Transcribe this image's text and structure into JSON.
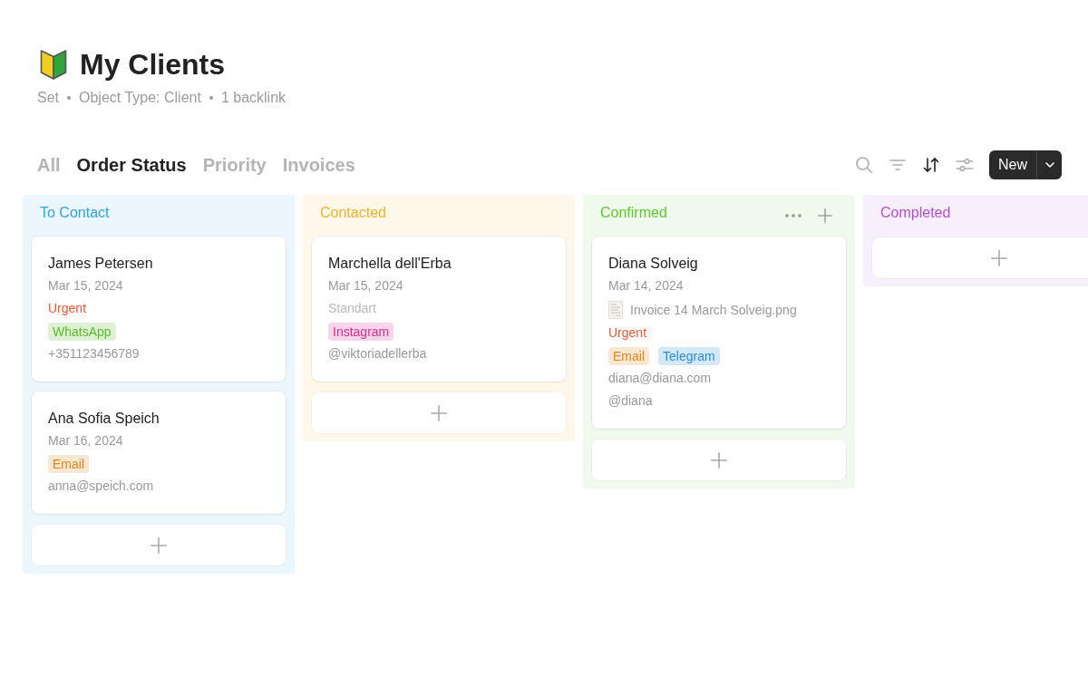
{
  "page": {
    "title": "My Clients",
    "meta": [
      "Set",
      "Object Type: Client",
      "1 backlink"
    ]
  },
  "tabs": [
    {
      "label": "All",
      "selected": false
    },
    {
      "label": "Order Status",
      "selected": true
    },
    {
      "label": "Priority",
      "selected": false
    },
    {
      "label": "Invoices",
      "selected": false
    }
  ],
  "toolbar": {
    "tools": [
      {
        "kind": "search",
        "active": false
      },
      {
        "kind": "filter",
        "active": false
      },
      {
        "kind": "sort",
        "active": true
      },
      {
        "kind": "settings",
        "active": false
      }
    ],
    "new_button": {
      "label": "New"
    }
  },
  "board": {
    "columns": [
      {
        "title": "To Contact",
        "color": "#2ea3e8",
        "hovered": false,
        "cards": [
          {
            "name": "James Petersen",
            "fields": [
              {
                "kind": "date",
                "text": "Mar 15, 2024"
              },
              {
                "kind": "priority",
                "text": "Urgent",
                "color": "#f2562f"
              },
              {
                "kind": "tags",
                "tags": [
                  {
                    "label": "WhatsApp",
                    "color": "#5cb82a"
                  }
                ]
              },
              {
                "kind": "text",
                "text": "+351123456789"
              }
            ]
          },
          {
            "name": "Ana Sofia Speich",
            "fields": [
              {
                "kind": "date",
                "text": "Mar 16, 2024"
              },
              {
                "kind": "tags",
                "tags": [
                  {
                    "label": "Email",
                    "color": "#e3861b"
                  }
                ]
              },
              {
                "kind": "text",
                "text": "anna@speich.com"
              }
            ]
          }
        ]
      },
      {
        "title": "Contacted",
        "color": "#f5b226",
        "hovered": false,
        "cards": [
          {
            "name": "Marchella dell'Erba",
            "fields": [
              {
                "kind": "date",
                "text": "Mar 15, 2024"
              },
              {
                "kind": "priority",
                "text": "Standart",
                "color": "#b9b9b9"
              },
              {
                "kind": "tags",
                "tags": [
                  {
                    "label": "Instagram",
                    "color": "#de2d8e"
                  }
                ]
              },
              {
                "kind": "text",
                "text": "@viktoriadellerba"
              }
            ]
          }
        ]
      },
      {
        "title": "Confirmed",
        "color": "#5cc92e",
        "hovered": true,
        "cards": [
          {
            "name": "Diana Solveig",
            "fields": [
              {
                "kind": "date",
                "text": "Mar 14, 2024"
              },
              {
                "kind": "file",
                "text": "Invoice 14 March Solveig.png"
              },
              {
                "kind": "priority",
                "text": "Urgent",
                "color": "#f2562f"
              },
              {
                "kind": "tags",
                "tags": [
                  {
                    "label": "Email",
                    "color": "#e3861b"
                  },
                  {
                    "label": "Telegram",
                    "color": "#2a8ed6"
                  }
                ]
              },
              {
                "kind": "text",
                "text": "diana@diana.com"
              },
              {
                "kind": "text",
                "text": "@diana"
              }
            ]
          }
        ]
      },
      {
        "title": "Completed",
        "color": "#b24fd9",
        "hovered": false
      }
    ]
  }
}
